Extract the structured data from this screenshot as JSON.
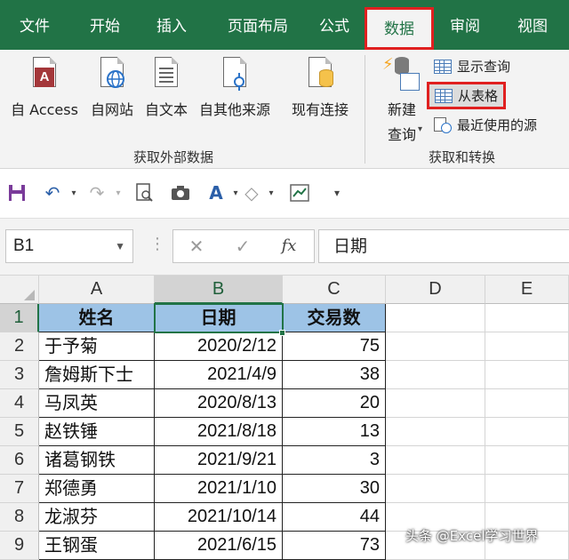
{
  "ribbon_tabs": [
    "文件",
    "开始",
    "插入",
    "页面布局",
    "公式",
    "数据",
    "审阅",
    "视图"
  ],
  "active_tab": "数据",
  "get_external_data": {
    "from_access": "自 Access",
    "from_web": "自网站",
    "from_text": "自文本",
    "from_other": "自其他来源",
    "existing_connections": "现有连接",
    "group_label": "获取外部数据"
  },
  "get_transform": {
    "new_query_line1": "新建",
    "new_query_line2": "查询",
    "show_queries": "显示查询",
    "from_table": "从表格",
    "recent_sources": "最近使用的源",
    "group_label": "获取和转换"
  },
  "formula_bar": {
    "name_box": "B1",
    "cancel": "✕",
    "enter": "✓",
    "fx": "fx",
    "content": "日期"
  },
  "columns": [
    "A",
    "B",
    "C",
    "D",
    "E"
  ],
  "rows": [
    "1",
    "2",
    "3",
    "4",
    "5",
    "6",
    "7",
    "8",
    "9"
  ],
  "table": {
    "headers": [
      "姓名",
      "日期",
      "交易数"
    ],
    "data": [
      [
        "于予菊",
        "2020/2/12",
        "75"
      ],
      [
        "詹姆斯下士",
        "2021/4/9",
        "38"
      ],
      [
        "马凤英",
        "2020/8/13",
        "20"
      ],
      [
        "赵铁锤",
        "2021/8/18",
        "13"
      ],
      [
        "诸葛钢铁",
        "2021/9/21",
        "3"
      ],
      [
        "郑德勇",
        "2021/1/10",
        "30"
      ],
      [
        "龙淑芬",
        "2021/10/14",
        "44"
      ],
      [
        "王钢蛋",
        "2021/6/15",
        "73"
      ]
    ]
  },
  "watermark": "头条 @Excel学习世界",
  "colors": {
    "excel_green": "#217346",
    "header_fill": "#9dc3e6",
    "highlight_red": "#e02020"
  }
}
